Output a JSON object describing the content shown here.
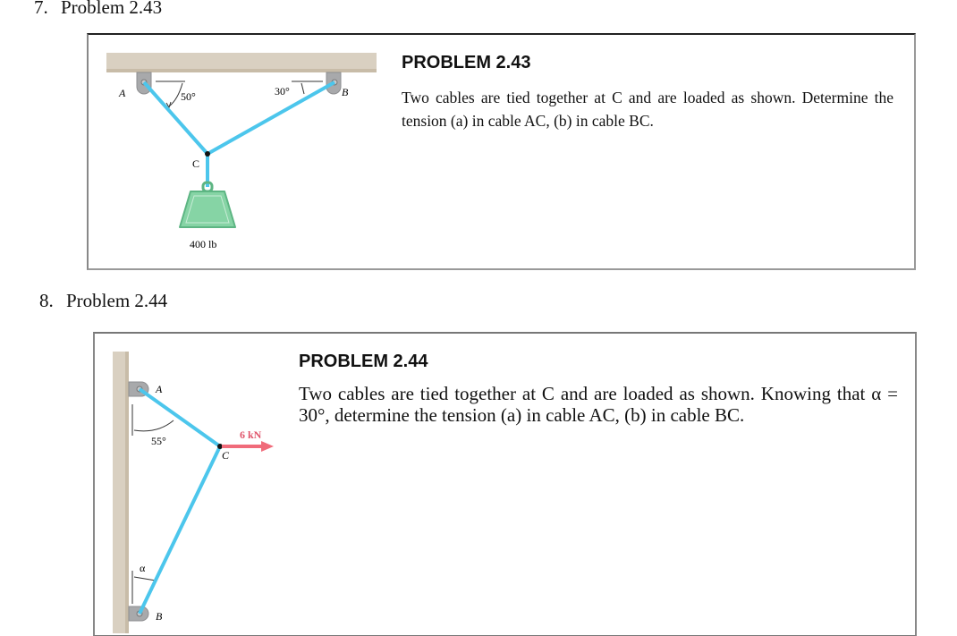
{
  "document": {
    "items": [
      {
        "number": "7.",
        "heading": "Problem 2.43",
        "problem_title": "PROBLEM 2.43",
        "problem_text": "Two cables are tied together at C and are loaded as shown. Determine the tension (a) in cable AC, (b) in cable BC.",
        "figure": {
          "labels": {
            "point_a": "A",
            "point_b": "B",
            "point_c": "C",
            "angle_a": "50°",
            "angle_b": "30°",
            "load": "400 lb"
          }
        }
      },
      {
        "number": "8.",
        "heading": "Problem 2.44",
        "problem_title": "PROBLEM 2.44",
        "problem_text": "Two cables are tied together at C and are loaded as shown. Knowing that α = 30°, determine the tension (a) in cable AC, (b) in cable BC.",
        "figure": {
          "labels": {
            "point_a": "A",
            "point_b": "B",
            "point_c": "C",
            "angle_a": "55°",
            "angle_b": "α",
            "load": "6 kN"
          }
        }
      }
    ]
  },
  "colors": {
    "cable": "#4cc6ec",
    "support_beam": "#d7cdbd",
    "bracket": "#a9aaac",
    "weight": "#7fcf9e",
    "force_arrow": "#f06b7a"
  }
}
